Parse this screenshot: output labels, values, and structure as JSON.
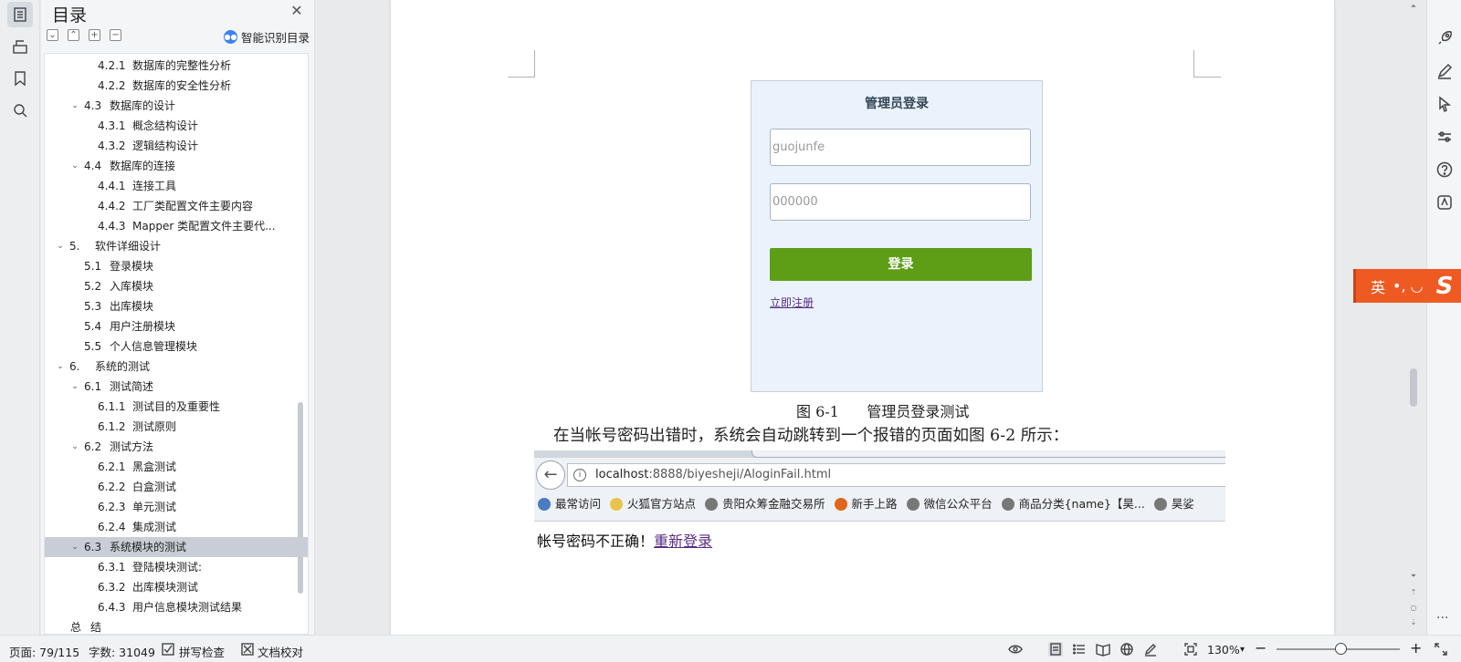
{
  "toc": {
    "title": "目录",
    "smart_label": "智能识别目录",
    "tool_buttons": [
      "⌄",
      "⌃",
      "+",
      "−"
    ],
    "items": [
      {
        "num": "4.2.1",
        "label": "数据库的完整性分析",
        "level": 3,
        "caret": ""
      },
      {
        "num": "4.2.2",
        "label": "数据库的安全性分析",
        "level": 3,
        "caret": ""
      },
      {
        "num": "4.3",
        "label": "数据库的设计",
        "level": 2,
        "caret": "v"
      },
      {
        "num": "4.3.1",
        "label": "概念结构设计",
        "level": 3,
        "caret": ""
      },
      {
        "num": "4.3.2",
        "label": "逻辑结构设计",
        "level": 3,
        "caret": ""
      },
      {
        "num": "4.4",
        "label": "数据库的连接",
        "level": 2,
        "caret": "v"
      },
      {
        "num": "4.4.1",
        "label": "连接工具",
        "level": 3,
        "caret": ""
      },
      {
        "num": "4.4.2",
        "label": "工厂类配置文件主要内容",
        "level": 3,
        "caret": ""
      },
      {
        "num": "4.4.3",
        "label": "Mapper 类配置文件主要代...",
        "level": 3,
        "caret": ""
      },
      {
        "num": "5.",
        "label": "软件详细设计",
        "level": 1,
        "caret": "v"
      },
      {
        "num": "5.1",
        "label": "登录模块",
        "level": 2,
        "caret": ""
      },
      {
        "num": "5.2",
        "label": "入库模块",
        "level": 2,
        "caret": ""
      },
      {
        "num": "5.3",
        "label": "出库模块",
        "level": 2,
        "caret": ""
      },
      {
        "num": "5.4",
        "label": "用户注册模块",
        "level": 2,
        "caret": ""
      },
      {
        "num": "5.5",
        "label": "个人信息管理模块",
        "level": 2,
        "caret": ""
      },
      {
        "num": "6.",
        "label": "系统的测试",
        "level": 1,
        "caret": "v"
      },
      {
        "num": "6.1",
        "label": "测试简述",
        "level": 2,
        "caret": "v"
      },
      {
        "num": "6.1.1",
        "label": "测试目的及重要性",
        "level": 3,
        "caret": ""
      },
      {
        "num": "6.1.2",
        "label": "测试原则",
        "level": 3,
        "caret": ""
      },
      {
        "num": "6.2",
        "label": "测试方法",
        "level": 2,
        "caret": "v"
      },
      {
        "num": "6.2.1",
        "label": "黑盒测试",
        "level": 3,
        "caret": ""
      },
      {
        "num": "6.2.2",
        "label": "白盒测试",
        "level": 3,
        "caret": ""
      },
      {
        "num": "6.2.3",
        "label": "单元测试",
        "level": 3,
        "caret": ""
      },
      {
        "num": "6.2.4",
        "label": "集成测试",
        "level": 3,
        "caret": ""
      },
      {
        "num": "6.3",
        "label": "系统模块的测试",
        "level": 2,
        "caret": "v",
        "selected": true
      },
      {
        "num": "6.3.1",
        "label": "登陆模块测试:",
        "level": 3,
        "caret": ""
      },
      {
        "num": "6.3.2",
        "label": "出库模块测试",
        "level": 3,
        "caret": ""
      },
      {
        "num": "6.4.3",
        "label": "用户信息模块测试结果",
        "level": 3,
        "caret": ""
      },
      {
        "num": "总",
        "label": "结",
        "level": 0,
        "caret": ""
      }
    ]
  },
  "login": {
    "title": "管理员登录",
    "username_value": "guojunfe",
    "password_value": "000000",
    "submit_label": "登录",
    "register_link": "立即注册"
  },
  "figure_caption": "图 6-1      管理员登录测试",
  "paragraph": "在当帐号密码出错时，系统会自动跳转到一个报错的页面如图 6-2 所示：",
  "browser": {
    "url_host": "localhost",
    "url_rest": ":8888/biyesheji/AloginFail.html",
    "bookmarks": [
      {
        "label": "最常访问",
        "color": "#4a7cc0"
      },
      {
        "label": "火狐官方站点",
        "color": "#e8c54a"
      },
      {
        "label": "贵阳众筹金融交易所",
        "color": "#777777"
      },
      {
        "label": "新手上路",
        "color": "#e0661c"
      },
      {
        "label": "微信公众平台",
        "color": "#777777"
      },
      {
        "label": "商品分类{name}【昊...",
        "color": "#777777"
      },
      {
        "label": "昊娑",
        "color": "#777777"
      }
    ]
  },
  "error": {
    "message": "帐号密码不正确！",
    "relogin_link": "重新登录"
  },
  "ime": {
    "label": "英",
    "mid": "•, ◡",
    "logo": "S"
  },
  "status": {
    "page": "页面: 79/115",
    "words": "字数: 31049",
    "spell_check": "拼写检查",
    "doc_check": "文档校对",
    "zoom": "130%"
  }
}
